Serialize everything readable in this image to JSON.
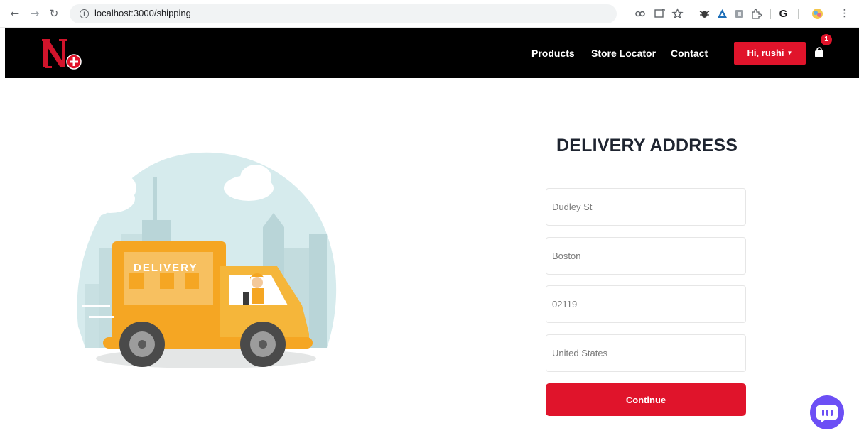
{
  "browser": {
    "url": "localhost:3000/shipping",
    "back_icon": "←",
    "forward_icon": "→",
    "reload_icon": "↻",
    "info_icon": "i",
    "menu_icon": "⋮"
  },
  "navbar": {
    "links": [
      "Products",
      "Store Locator",
      "Contact"
    ],
    "user_label": "Hi, rushi",
    "cart_count": "1",
    "accent": "#e0142b"
  },
  "illustration": {
    "truck_text": "DELIVERY"
  },
  "form": {
    "title": "DELIVERY ADDRESS",
    "street": "Dudley St",
    "city": "Boston",
    "zip": "02119",
    "country": "United States",
    "continue_label": "Continue"
  }
}
